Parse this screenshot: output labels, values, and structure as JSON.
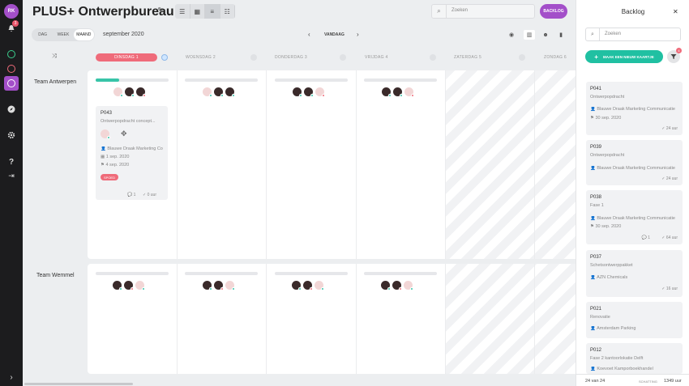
{
  "user": {
    "initials": "RK",
    "notifications": "3"
  },
  "header": {
    "title": "PLUS+ Ontwerpbureau",
    "search_placeholder": "Zoeken",
    "backlog_button": "BACKLOG"
  },
  "toolbar": {
    "ranges": [
      "DAG",
      "WEEK",
      "MAAND"
    ],
    "selected_range": "MAAND",
    "month": "september 2020",
    "today": "VANDAAG"
  },
  "days": [
    "DINSDAG 1",
    "WOENSDAG 2",
    "DONDERDAG 3",
    "VRIJDAG 4",
    "ZATERDAG 5",
    "ZONDAG 6"
  ],
  "teams": [
    "Team Antwerpen",
    "Team Wemmel"
  ],
  "task": {
    "code": "P043",
    "subtitle": "Ontwerpopdracht concept...",
    "client": "Blauwe Draak Marketing Co",
    "start": "1 sep. 2020",
    "end": "4 sep. 2020",
    "tag": "SPOED",
    "comments": "1",
    "hours": "0 uur"
  },
  "backlog": {
    "title": "Backlog",
    "search_placeholder": "Zoeken",
    "new_button": "MAAK EEN NIEUW KAARTJE",
    "filter_badge": "4",
    "cards": [
      {
        "code": "P041",
        "subtitle": "Ontwerpopdracht",
        "client": "Blauwe Draak Marketing Communicatie",
        "date": "30 sep. 2020",
        "comments": "",
        "hours": "24 uur"
      },
      {
        "code": "P039",
        "subtitle": "Ontwerpopdracht",
        "client": "Blauwe Draak Marketing Communicatie",
        "date": "",
        "comments": "",
        "hours": "24 uur"
      },
      {
        "code": "P038",
        "subtitle": "Fase 1",
        "client": "Blauwe Draak Marketing Communicatie",
        "date": "30 sep. 2020",
        "comments": "1",
        "hours": "64 uur"
      },
      {
        "code": "P037",
        "subtitle": "Schetsontwerppakket",
        "client": "AZN Chemicals",
        "date": "",
        "comments": "",
        "hours": "16 uur"
      },
      {
        "code": "P021",
        "subtitle": "Renovatie",
        "client": "Amsterdam Parking",
        "date": "",
        "comments": "",
        "hours": ""
      },
      {
        "code": "P012",
        "subtitle": "Fase 2 kantoorlokatie Delft",
        "client": "Koevoet Kamporboekhandel",
        "date": "",
        "comments": "",
        "hours": ""
      }
    ],
    "count": "24 van 24",
    "estimate_label": "SCHATTING",
    "estimate_value": "1349 uur"
  }
}
